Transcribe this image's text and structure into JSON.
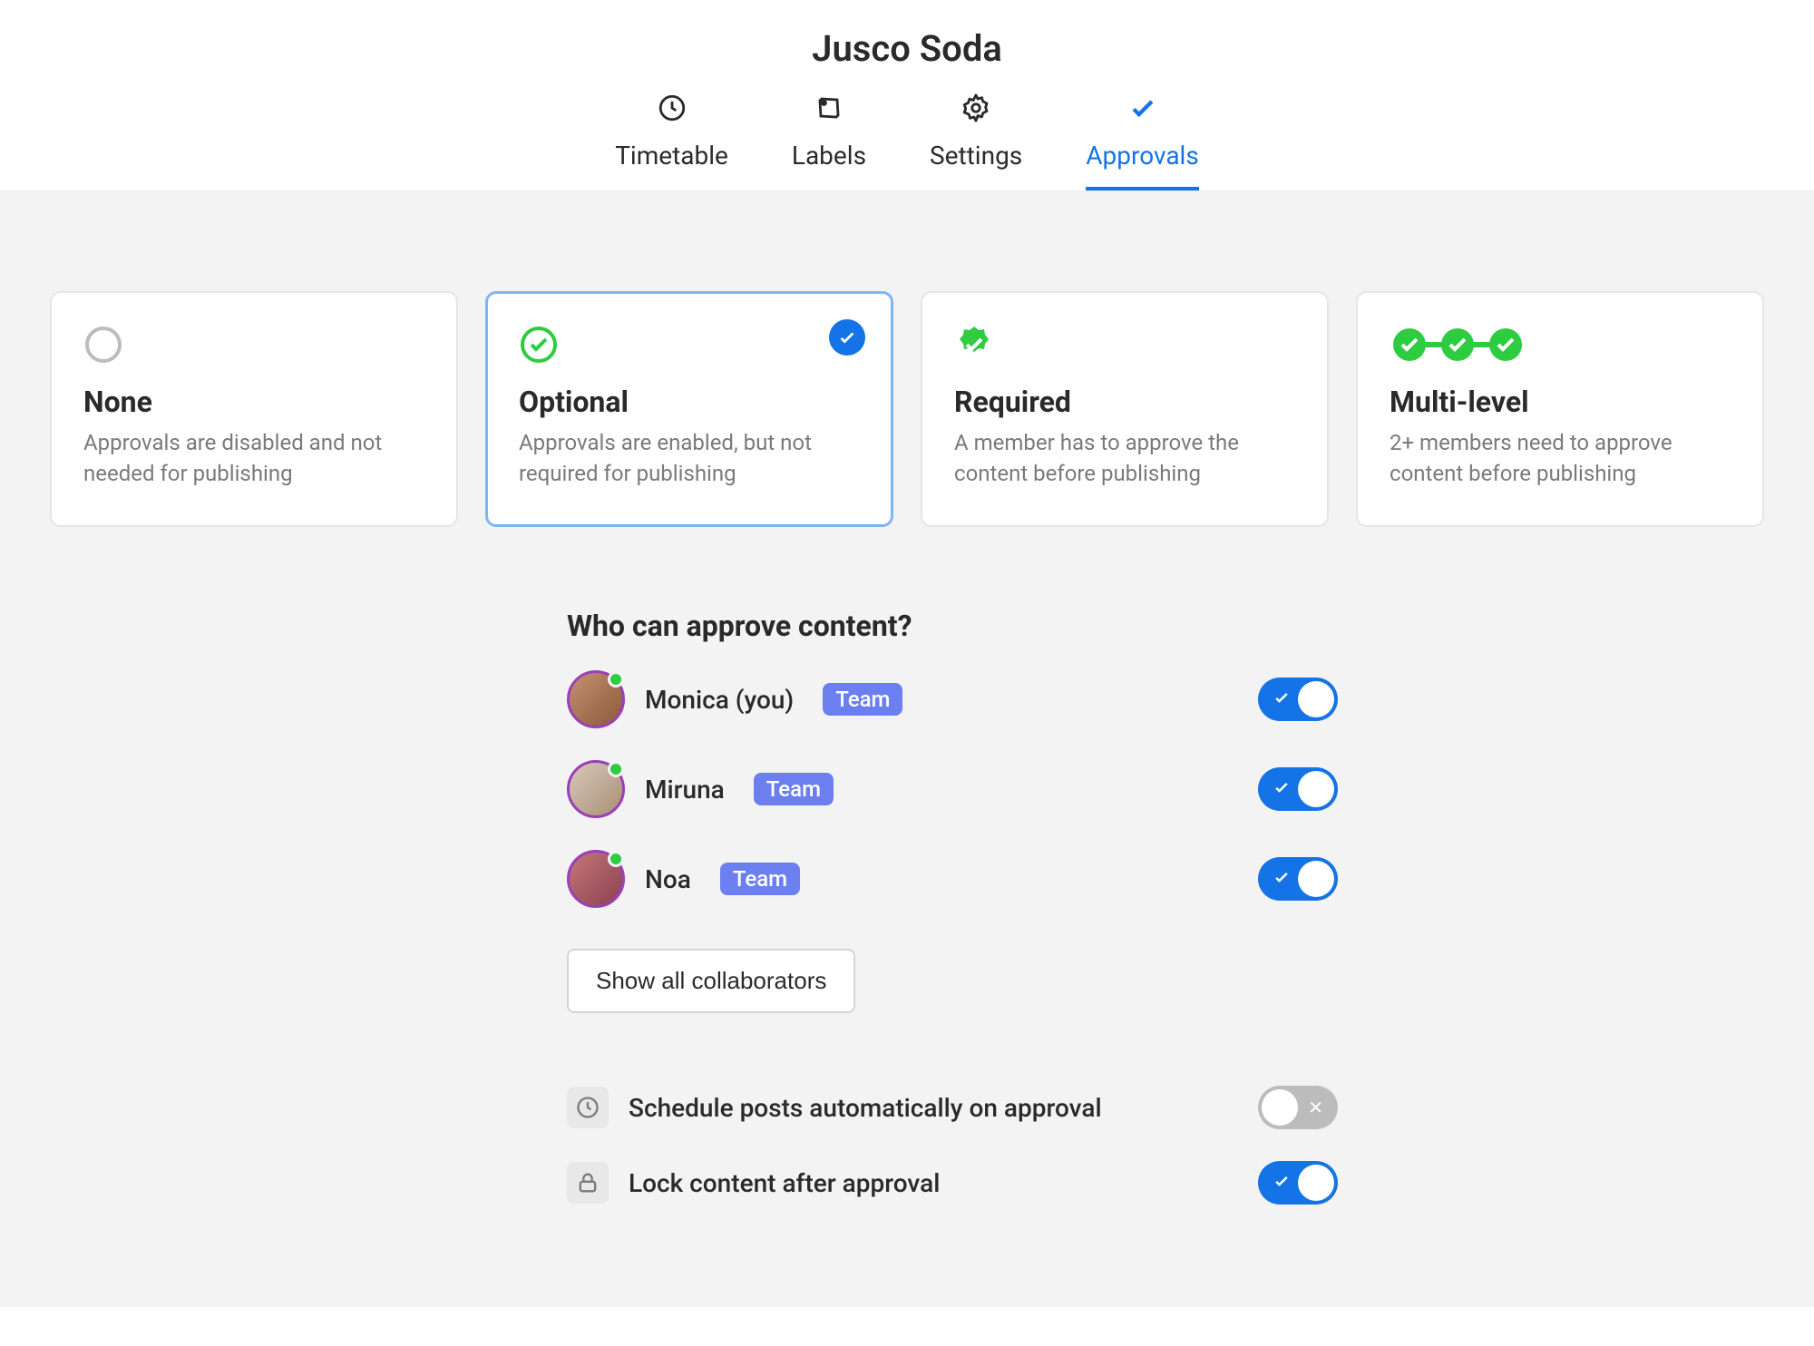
{
  "header": {
    "title": "Jusco Soda",
    "tabs": [
      {
        "label": "Timetable",
        "icon": "clock-icon",
        "active": false
      },
      {
        "label": "Labels",
        "icon": "tag-icon",
        "active": false
      },
      {
        "label": "Settings",
        "icon": "gear-icon",
        "active": false
      },
      {
        "label": "Approvals",
        "icon": "check-icon",
        "active": true
      }
    ]
  },
  "cards": [
    {
      "id": "none",
      "title": "None",
      "desc": "Approvals are disabled and not needed for publishing",
      "selected": false
    },
    {
      "id": "optional",
      "title": "Optional",
      "desc": "Approvals are enabled, but not required for publishing",
      "selected": true
    },
    {
      "id": "required",
      "title": "Required",
      "desc": "A member has to approve the content before publishing",
      "selected": false
    },
    {
      "id": "multilevel",
      "title": "Multi-level",
      "desc": "2+ members need to approve content before publishing",
      "selected": false
    }
  ],
  "approvers": {
    "title": "Who can approve content?",
    "list": [
      {
        "name": "Monica (you)",
        "role": "Team",
        "enabled": true
      },
      {
        "name": "Miruna",
        "role": "Team",
        "enabled": true
      },
      {
        "name": "Noa",
        "role": "Team",
        "enabled": true
      }
    ],
    "show_all_label": "Show all collaborators"
  },
  "options": [
    {
      "icon": "clock-icon",
      "label": "Schedule posts automatically on approval",
      "enabled": false
    },
    {
      "icon": "lock-icon",
      "label": "Lock content after approval",
      "enabled": true
    }
  ]
}
